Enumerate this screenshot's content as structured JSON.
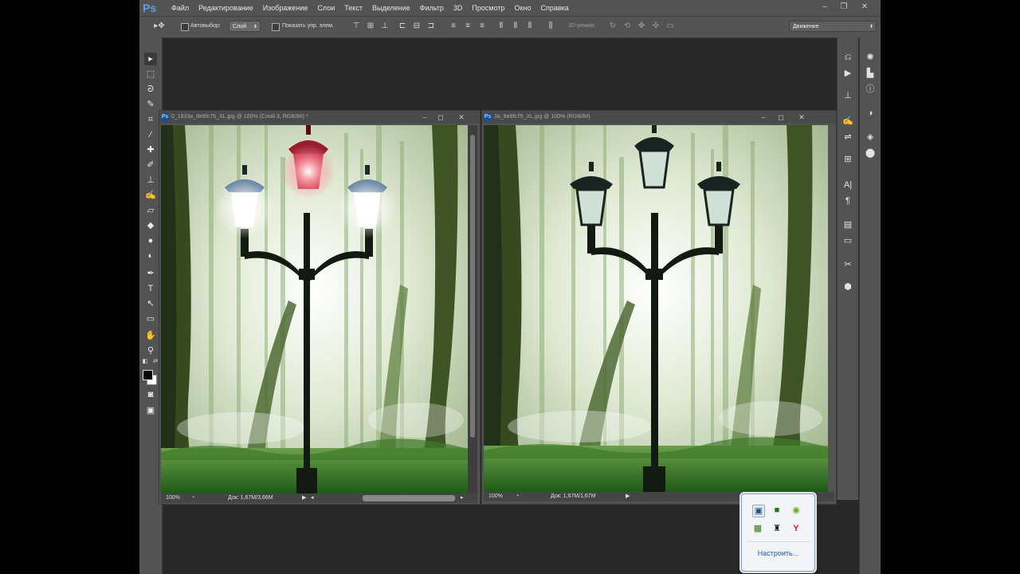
{
  "app": {
    "logo": "Ps",
    "menu": [
      "Файл",
      "Редактирование",
      "Изображение",
      "Слои",
      "Текст",
      "Выделение",
      "Фильтр",
      "3D",
      "Просмотр",
      "Окно",
      "Справка"
    ],
    "window_controls": {
      "minimize": "–",
      "restore": "❐",
      "close": "✕"
    }
  },
  "options": {
    "autoselect_label": "Автовыбор:",
    "autoselect_value": "Слой",
    "show_controls_label": "Показать упр. элем.",
    "mode_3d_label": "3D-режим:",
    "workspace_value": "Движение"
  },
  "toolbar": {
    "tools": [
      "move-icon",
      "marquee-icon",
      "lasso-icon",
      "quick-select-icon",
      "crop-icon",
      "eyedropper-icon",
      "healing-icon",
      "brush-icon",
      "stamp-icon",
      "history-brush-icon",
      "eraser-icon",
      "bucket-icon",
      "blur-icon",
      "dodge-icon",
      "pen-icon",
      "type-icon",
      "path-select-icon",
      "rectangle-icon",
      "hand-icon",
      "zoom-icon"
    ],
    "foreground_color": "#000000",
    "background_color": "#ffffff"
  },
  "documents": [
    {
      "title": "0_1833a_8e8fc75_XL.jpg @ 100% (Слой 3, RGB/8#) *",
      "zoom": "100%",
      "doc_size": "Док: 1,67М/3,66М",
      "lamps_lit": true
    },
    {
      "title": "3a_8e8fc75_XL.jpg @ 100% (RGB/8#)",
      "zoom": "100%",
      "doc_size": "Док: 1,67М/1,67М",
      "lamps_lit": false
    }
  ],
  "tray_popup": {
    "icons": [
      "monitor-icon",
      "nvidia-square-icon",
      "refresh-green-icon",
      "nvidia-icon",
      "usb-icon",
      "yandex-icon"
    ],
    "customize_label": "Настроить..."
  },
  "colors": {
    "ui_panel": "#535353",
    "workspace": "#282828",
    "lamp_lit_red": "#c0283c",
    "link_blue": "#1f5aa6"
  }
}
